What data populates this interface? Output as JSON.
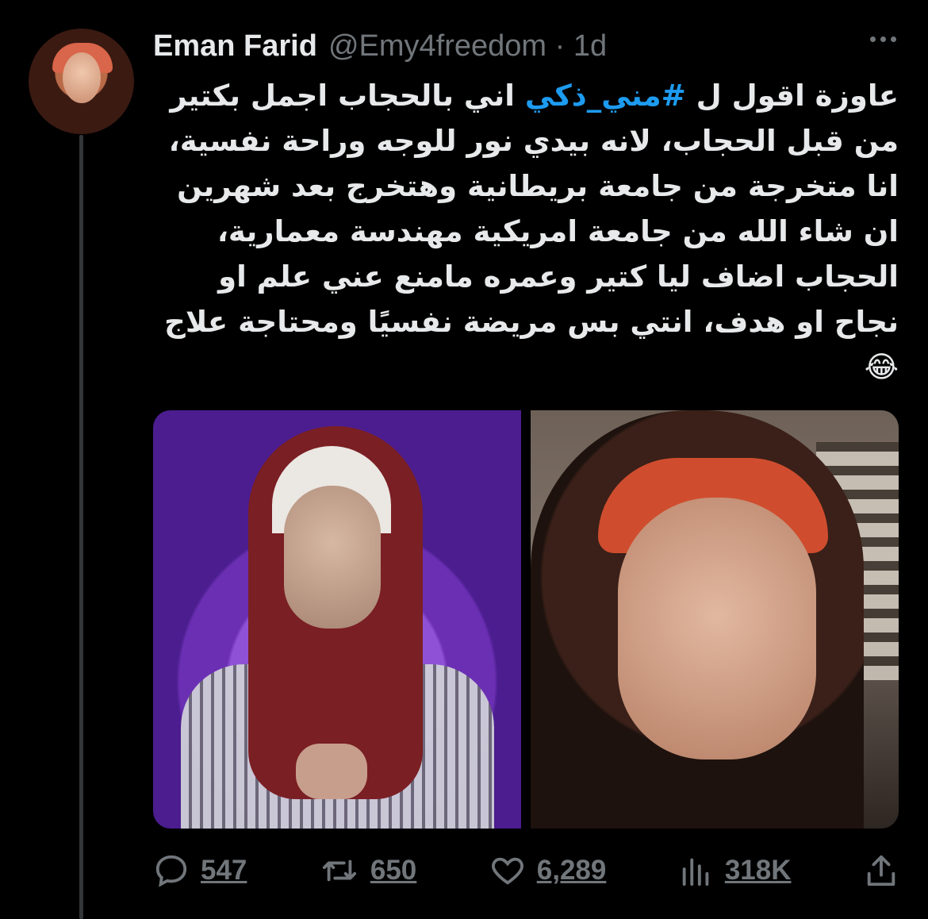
{
  "tweet": {
    "display_name": "Eman Farid",
    "handle_meta": "@Emy4freedom · 1d",
    "text_before": "عاوزة اقول ل ",
    "hashtag": "#مني_ذكي",
    "text_after": " اني بالحجاب اجمل بكتير من قبل الحجاب، لانه بيدي نور للوجه وراحة نفسية، انا متخرجة من جامعة بريطانية وهتخرج بعد شهرين ان شاء الله من جامعة امريكية مهندسة معمارية، الحجاب اضاف ليا كتير وعمره مامنع عني علم او نجاح او هدف، انتي بس مريضة نفسيًا ومحتاجة علاج😂"
  },
  "actions": {
    "replies": "547",
    "retweets": "650",
    "likes": "6,289",
    "views": "318K"
  },
  "icons": {
    "reply": "reply-bubble-icon",
    "retweet": "retweet-arrows-icon",
    "like": "heart-icon",
    "views": "bar-chart-icon",
    "share": "share-upload-icon",
    "more": "more-dots-icon"
  },
  "colors": {
    "background": "#000000",
    "text": "#e7e9ea",
    "muted": "#71767b",
    "accent": "#1d9bf0"
  }
}
